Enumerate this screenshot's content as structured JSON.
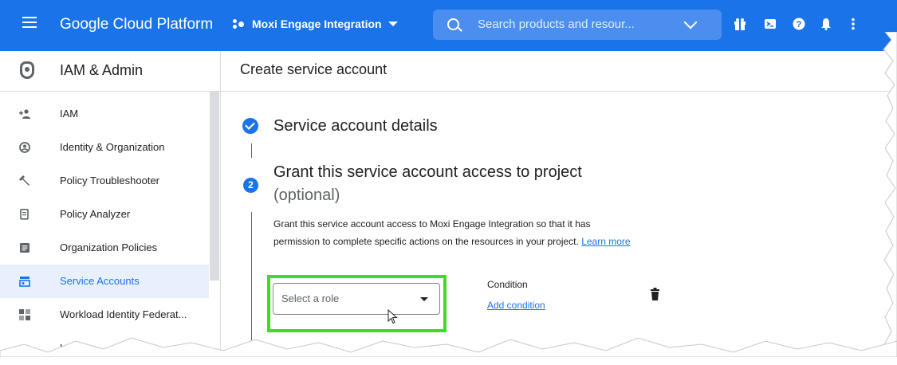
{
  "topbar": {
    "brand": "Google Cloud Platform",
    "project": "Moxi Engage Integration",
    "search_placeholder": "Search products and resour...",
    "icons": [
      "menu-icon",
      "gift-icon",
      "cloud-shell-icon",
      "help-icon",
      "notifications-icon",
      "more-vert-icon"
    ]
  },
  "sidebar": {
    "title": "IAM & Admin",
    "items": [
      {
        "label": "IAM",
        "icon": "person-add-icon"
      },
      {
        "label": "Identity & Organization",
        "icon": "account-circle-icon"
      },
      {
        "label": "Policy Troubleshooter",
        "icon": "wrench-icon"
      },
      {
        "label": "Policy Analyzer",
        "icon": "document-search-icon"
      },
      {
        "label": "Organization Policies",
        "icon": "list-document-icon"
      },
      {
        "label": "Service Accounts",
        "icon": "service-account-icon",
        "active": true
      },
      {
        "label": "Workload Identity Federat...",
        "icon": "workload-identity-icon"
      },
      {
        "label": "Labe",
        "icon": "label-icon"
      }
    ]
  },
  "main": {
    "page_title": "Create service account",
    "step1": {
      "title": "Service account details"
    },
    "step2": {
      "number": "2",
      "title": "Grant this service account access to project",
      "subtitle": "(optional)",
      "description_line1": "Grant this service account access to Moxi Engage Integration so that it has",
      "description_line2": "permission to complete specific actions on the resources in your project. ",
      "learn_more": "Learn more"
    },
    "role_select": {
      "placeholder": "Select a role"
    },
    "condition": {
      "label": "Condition",
      "add_link": "Add condition"
    }
  },
  "colors": {
    "primary": "#1a73e8",
    "highlight": "#3dde1e"
  }
}
